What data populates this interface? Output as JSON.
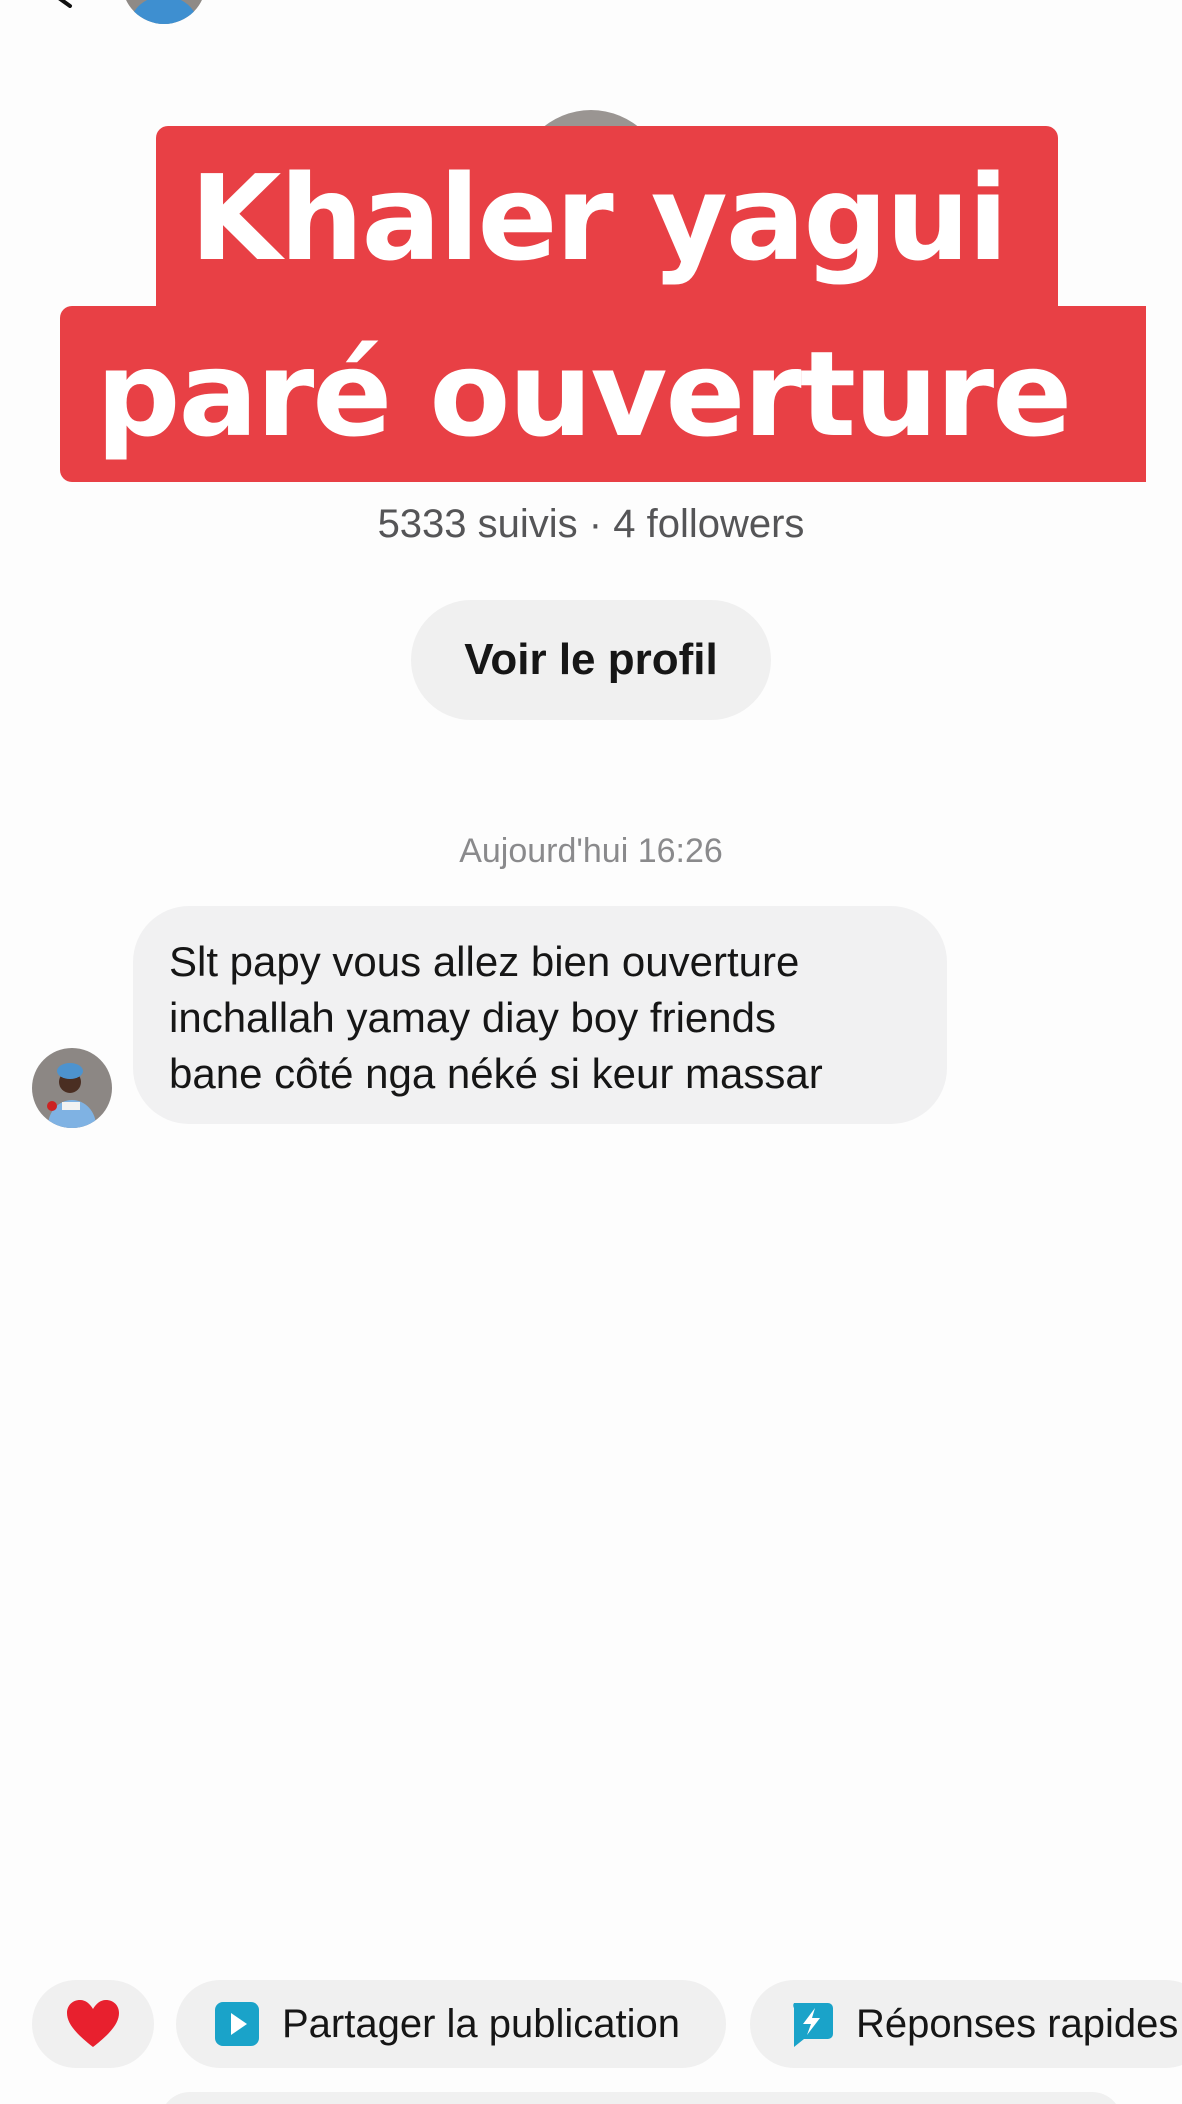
{
  "overlay": {
    "line1": "Khaler yagui",
    "line2": "paré ouverture"
  },
  "profile": {
    "stats": "5333 suivis · 4 followers",
    "view_profile_label": "Voir le profil"
  },
  "conversation": {
    "timestamp": "Aujourd'hui 16:26",
    "messages": [
      {
        "from": "other",
        "text": "Slt papy vous allez bien ouverture\ninchallah yamay diay boy friends\nbane côté nga néké si keur massar"
      }
    ]
  },
  "quick_actions": {
    "heart_icon": "red-heart-icon",
    "share_label": "Partager la publication",
    "share_icon": "play-square-icon",
    "quick_replies_label": "Réponses rapides",
    "quick_replies_icon": "lightning-bubble-icon"
  },
  "colors": {
    "overlay_red": "#e84045",
    "chip_bg": "#f0f0f0",
    "bubble_bg": "#f1f1f2",
    "share_icon_bg": "#1aa3c9",
    "heart": "#e8202e"
  }
}
